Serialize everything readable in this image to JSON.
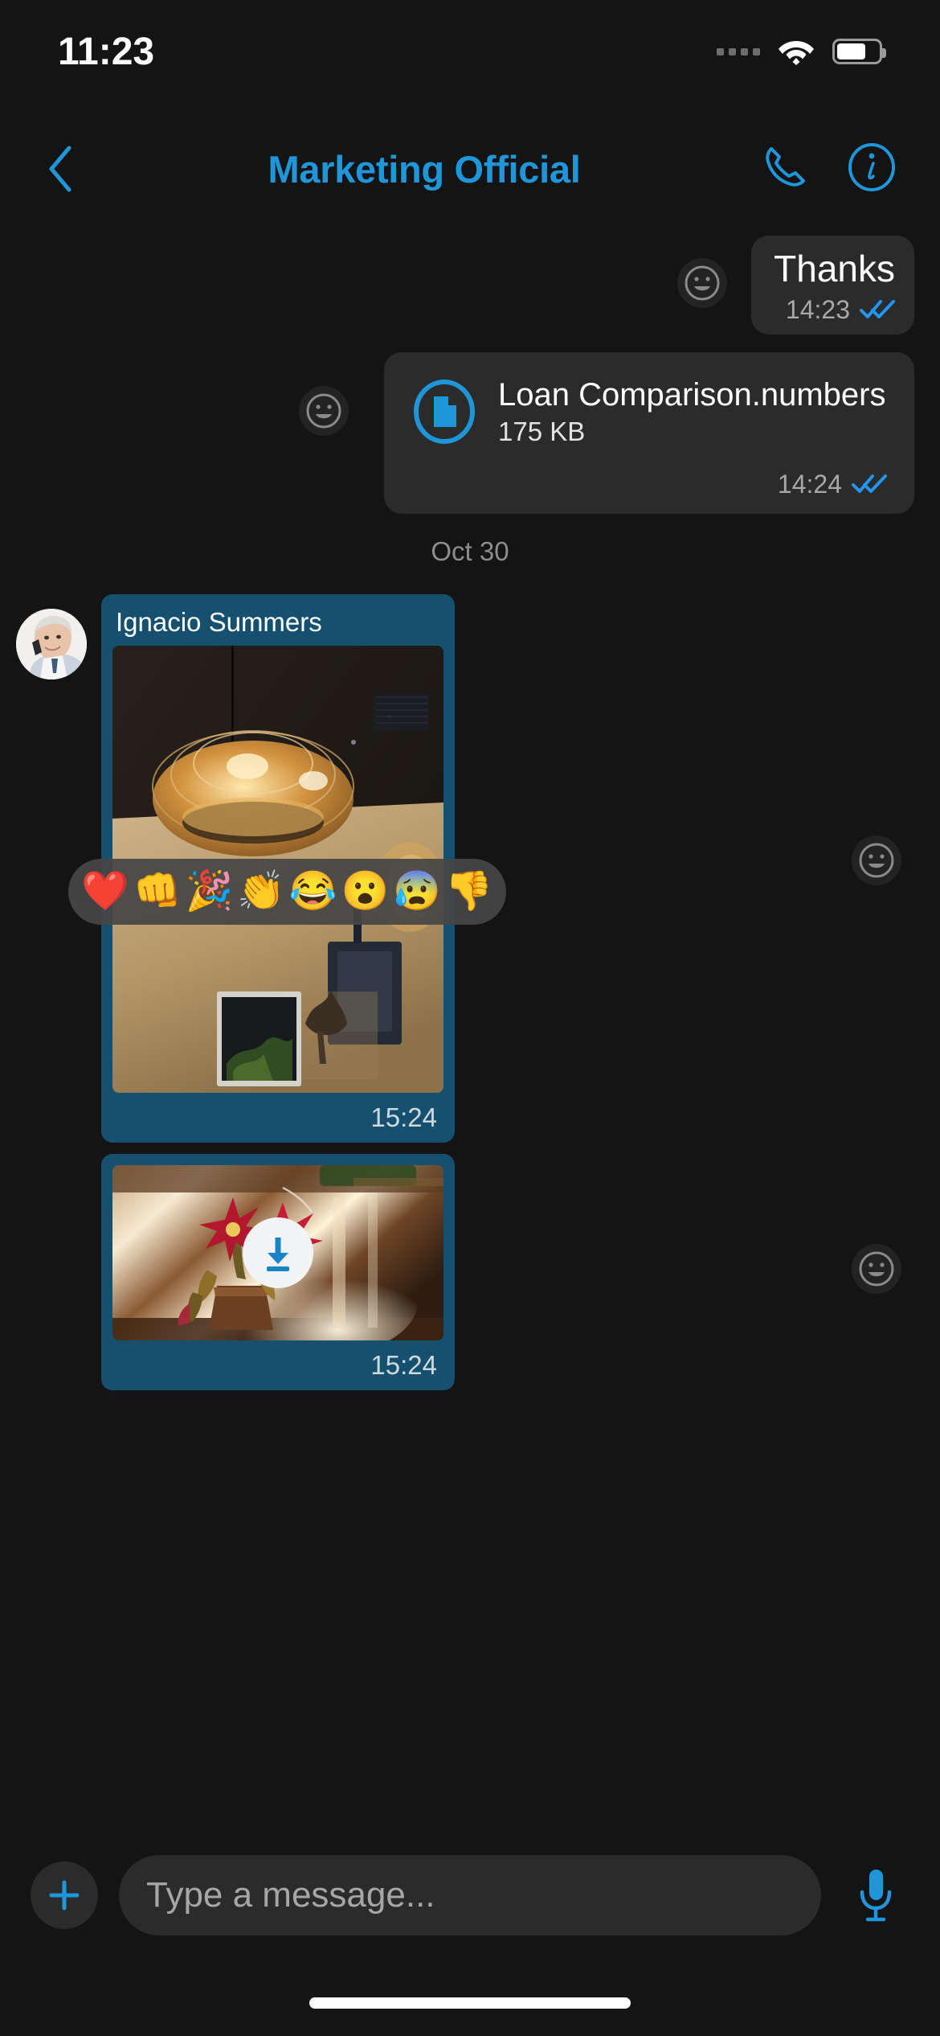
{
  "status_bar": {
    "time": "11:23",
    "signal_icon": "signal-dots-icon",
    "wifi_icon": "wifi-icon",
    "battery_icon": "battery-icon"
  },
  "header": {
    "back_icon": "chevron-left-icon",
    "title": "Marketing Official",
    "call_icon": "phone-icon",
    "info_icon": "info-circle-icon"
  },
  "colors": {
    "accent": "#1e96d9",
    "background": "#141414",
    "bubble_out": "#2b2b2b",
    "bubble_photo": "#15506e",
    "check_blue": "#2196f3",
    "reaction_bar": "#464646"
  },
  "messages": [
    {
      "id": "msg-thanks",
      "direction": "outgoing",
      "type": "text",
      "text": "Thanks",
      "time": "14:23",
      "status": "read",
      "reaction_button_icon": "smiley-add-reaction-icon"
    },
    {
      "id": "msg-file",
      "direction": "outgoing",
      "type": "file",
      "file_name": "Loan Comparison.numbers",
      "file_size": "175 KB",
      "file_icon": "document-icon",
      "time": "14:24",
      "status": "read",
      "reaction_button_icon": "smiley-add-reaction-icon"
    },
    {
      "id": "msg-photo-1",
      "direction": "incoming",
      "type": "photo",
      "sender": "Ignacio Summers",
      "caption": "",
      "time": "15:24",
      "photo_subject": "gold-chandelier-interior-photo",
      "reaction_button_icon": "smiley-add-reaction-icon"
    },
    {
      "id": "msg-photo-2",
      "direction": "incoming",
      "type": "photo",
      "sender": "",
      "time": "15:24",
      "photo_subject": "red-flowers-sunset-photo",
      "download_icon": "download-arrow-icon",
      "reaction_button_icon": "smiley-add-reaction-icon"
    }
  ],
  "date_separator": "Oct 30",
  "reaction_picker": {
    "visible": true,
    "emojis": [
      {
        "name": "heart-emoji",
        "glyph": "❤️"
      },
      {
        "name": "fist-bump-emoji",
        "glyph": "👊"
      },
      {
        "name": "party-popper-emoji",
        "glyph": "🎉"
      },
      {
        "name": "clapping-hands-emoji",
        "glyph": "👏"
      },
      {
        "name": "face-with-tears-of-joy-emoji",
        "glyph": "😂"
      },
      {
        "name": "face-with-open-mouth-emoji",
        "glyph": "😮"
      },
      {
        "name": "anxious-face-emoji",
        "glyph": "😰"
      },
      {
        "name": "thumbs-down-emoji",
        "glyph": "👎"
      }
    ]
  },
  "composer": {
    "attach_icon": "plus-icon",
    "placeholder": "Type a message...",
    "value": "",
    "mic_icon": "microphone-icon"
  }
}
